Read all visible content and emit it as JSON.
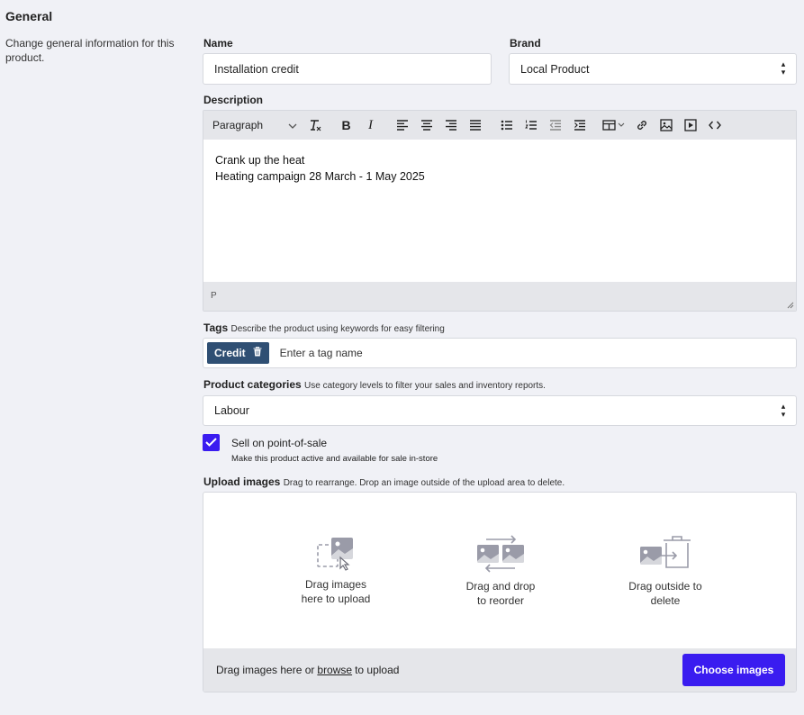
{
  "section": {
    "title": "General",
    "description": "Change general information for this product."
  },
  "name": {
    "label": "Name",
    "value": "Installation credit"
  },
  "brand": {
    "label": "Brand",
    "value": "Local Product"
  },
  "description": {
    "label": "Description",
    "toolbar": {
      "format_select": "Paragraph",
      "icons": [
        "clear-format-icon",
        "bold-icon",
        "italic-icon",
        "align-left-icon",
        "align-center-icon",
        "align-right-icon",
        "align-justify-icon",
        "bullet-list-icon",
        "numbered-list-icon",
        "outdent-icon",
        "indent-icon",
        "table-icon",
        "link-icon",
        "image-icon",
        "media-icon",
        "code-icon"
      ]
    },
    "content_lines": [
      "Crank up the heat",
      "Heating campaign 28 March - 1 May 2025"
    ],
    "status_path": "P"
  },
  "tags": {
    "label": "Tags",
    "hint": "Describe the product using keywords for easy filtering",
    "chips": [
      "Credit"
    ],
    "placeholder": "Enter a tag name"
  },
  "categories": {
    "label": "Product categories",
    "hint": "Use category levels to filter your sales and inventory reports.",
    "value": "Labour"
  },
  "pos": {
    "checked": true,
    "label": "Sell on point-of-sale",
    "sub": "Make this product active and available for sale in-store"
  },
  "upload": {
    "label": "Upload images",
    "hint": "Drag to rearrange. Drop an image outside of the upload area to delete.",
    "items": [
      {
        "line1": "Drag images",
        "line2": "here to upload"
      },
      {
        "line1": "Drag and drop",
        "line2": "to reorder"
      },
      {
        "line1": "Drag outside to",
        "line2": "delete"
      }
    ],
    "footer_prefix": "Drag images here or",
    "footer_link": "browse",
    "footer_suffix": "to upload",
    "button": "Choose images"
  },
  "colors": {
    "accent": "#3a1cf0",
    "tag_chip": "#2f4f73",
    "background": "#f0f1f6"
  }
}
